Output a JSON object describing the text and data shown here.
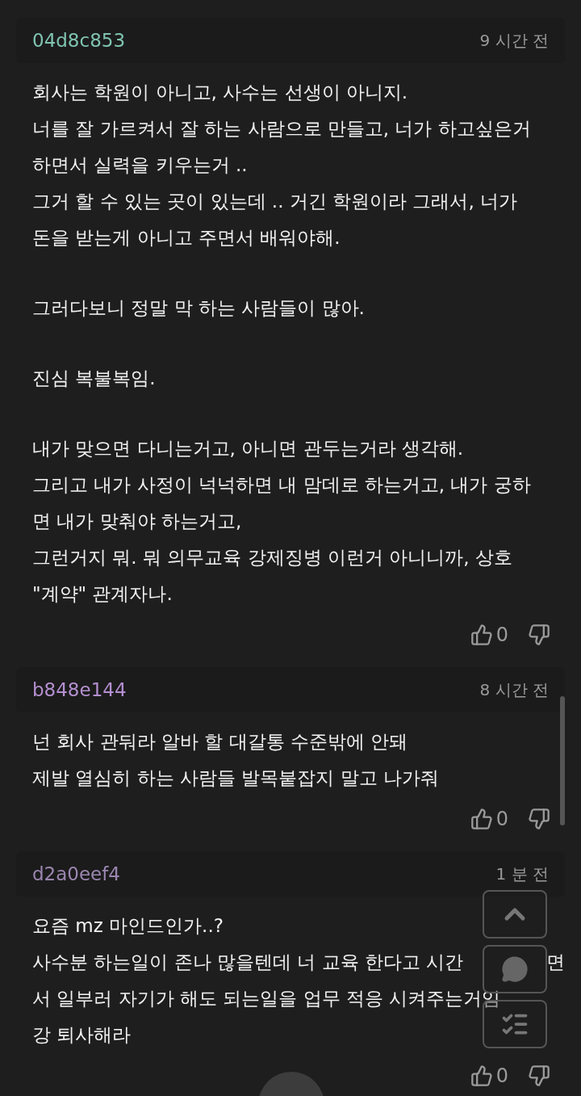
{
  "comments": [
    {
      "author": "04d8c853",
      "color": "#7fc4b0",
      "time": "9 시간 전",
      "paragraphs": [
        [
          "회사는 학원이 아니고, 사수는 선생이 아니지.",
          "너를 잘 가르켜서 잘 하는 사람으로 만들고, 너가 하고싶은거",
          "하면서 실력을 키우는거 ..",
          "그거 할 수 있는 곳이 있는데 .. 거긴 학원이라 그래서, 너가",
          "돈을 받는게 아니고 주면서 배워야해."
        ],
        [
          "그러다보니 정말 막 하는 사람들이 많아."
        ],
        [
          "진심 복불복임."
        ],
        [
          "내가 맞으면 다니는거고, 아니면 관두는거라 생각해.",
          "그리고 내가 사정이 넉넉하면 내 맘데로 하는거고, 내가 궁하",
          "면 내가 맞춰야 하는거고,",
          "그런거지 뭐. 뭐 의무교육 강제징병 이런거 아니니까, 상호",
          "\"계약\" 관계자나."
        ]
      ],
      "likes": "0"
    },
    {
      "author": "b848e144",
      "color": "#b48fd0",
      "time": "8 시간 전",
      "paragraphs": [
        [
          "넌 회사 관둬라 알바 할 대갈통 수준밖에 안돼",
          "제발 열심히 하는 사람들 발목붙잡지 말고 나가줘"
        ]
      ],
      "likes": "0"
    },
    {
      "author": "d2a0eef4",
      "color": "#9a86b0",
      "time": "1 분 전",
      "paragraphs": [
        [
          "요즘 mz 마인드인가..?",
          [
            "사수분 하는일이 존나 많을텐데 너 교육 한다고 시간",
            "면"
          ],
          "서 일부러 자기가 해도 되는일을 업무 적응 시켜주는거임",
          "강 퇴사해라"
        ]
      ],
      "likes": "0"
    }
  ]
}
